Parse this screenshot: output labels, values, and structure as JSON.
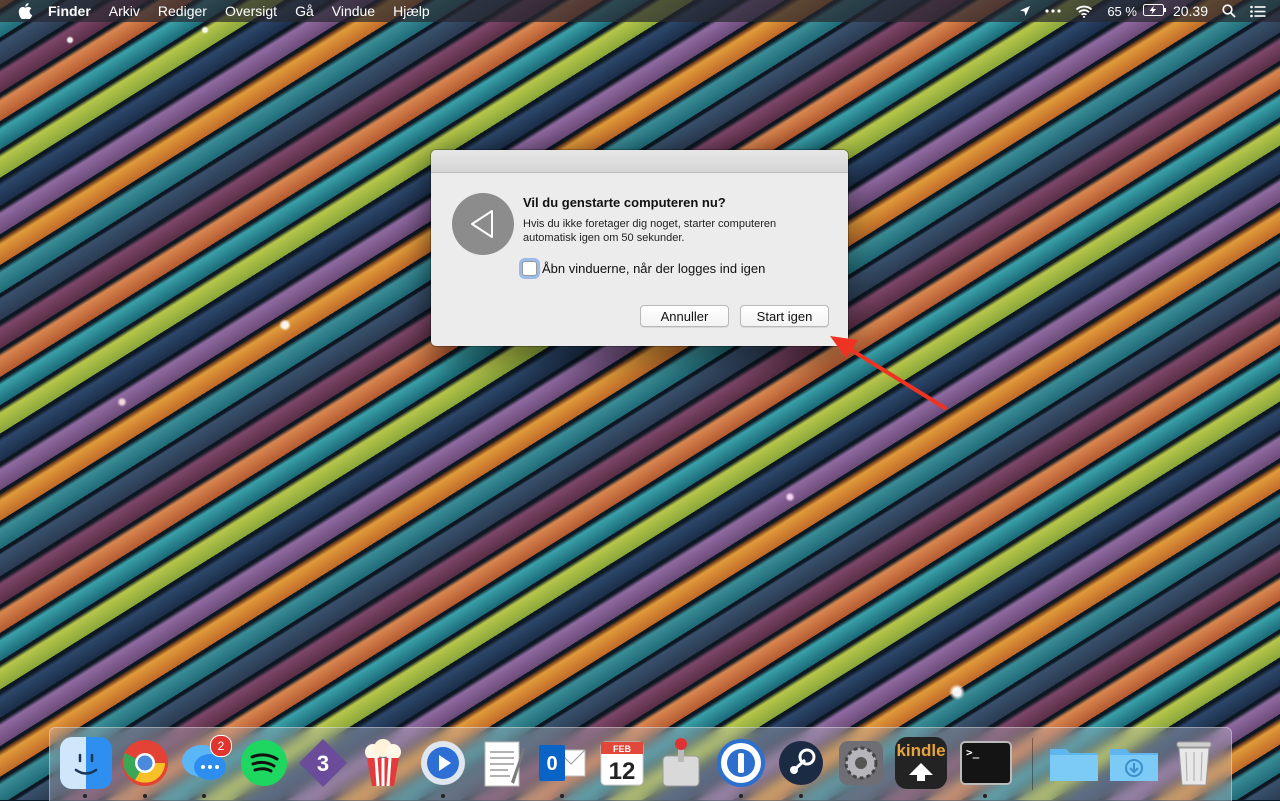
{
  "menubar": {
    "app_name": "Finder",
    "menus": [
      "Arkiv",
      "Rediger",
      "Oversigt",
      "Gå",
      "Vindue",
      "Hjælp"
    ],
    "status": {
      "battery_percent": "65 %",
      "clock": "20.39"
    }
  },
  "dialog": {
    "title": "Vil du genstarte computeren nu?",
    "message": "Hvis du ikke foretager dig noget, starter computeren automatisk igen om 50 sekunder.",
    "checkbox_label": "Åbn vinduerne, når der logges ind igen",
    "checkbox_checked": false,
    "cancel_label": "Annuller",
    "restart_label": "Start igen"
  },
  "dock": {
    "apps": [
      {
        "name": "Finder",
        "icon": "finder-icon"
      },
      {
        "name": "Chrome",
        "icon": "chrome-icon"
      },
      {
        "name": "Messages",
        "icon": "messages-icon",
        "badge": "2"
      },
      {
        "name": "Spotify",
        "icon": "spotify-icon"
      },
      {
        "name": "Ember",
        "icon": "ember-icon",
        "text": "3"
      },
      {
        "name": "Popcorn Time",
        "icon": "popcorn-icon"
      },
      {
        "name": "QuickTime",
        "icon": "quicktime-icon"
      },
      {
        "name": "TextEdit",
        "icon": "textedit-icon"
      },
      {
        "name": "Outlook",
        "icon": "outlook-icon",
        "text": "0"
      },
      {
        "name": "Calendar",
        "icon": "calendar-icon",
        "month": "FEB",
        "day": "12"
      },
      {
        "name": "Transmission",
        "icon": "transmission-icon"
      },
      {
        "name": "1Password",
        "icon": "onepassword-icon"
      },
      {
        "name": "Steam",
        "icon": "steam-icon"
      },
      {
        "name": "System Preferences",
        "icon": "system-preferences-icon"
      },
      {
        "name": "Kindle",
        "icon": "kindle-icon",
        "text": "kindle"
      },
      {
        "name": "Terminal",
        "icon": "terminal-icon",
        "text": ">_"
      },
      {
        "name": "Applications",
        "icon": "folder-icon"
      },
      {
        "name": "Downloads",
        "icon": "downloads-folder-icon"
      },
      {
        "name": "Trash",
        "icon": "trash-icon"
      }
    ]
  }
}
